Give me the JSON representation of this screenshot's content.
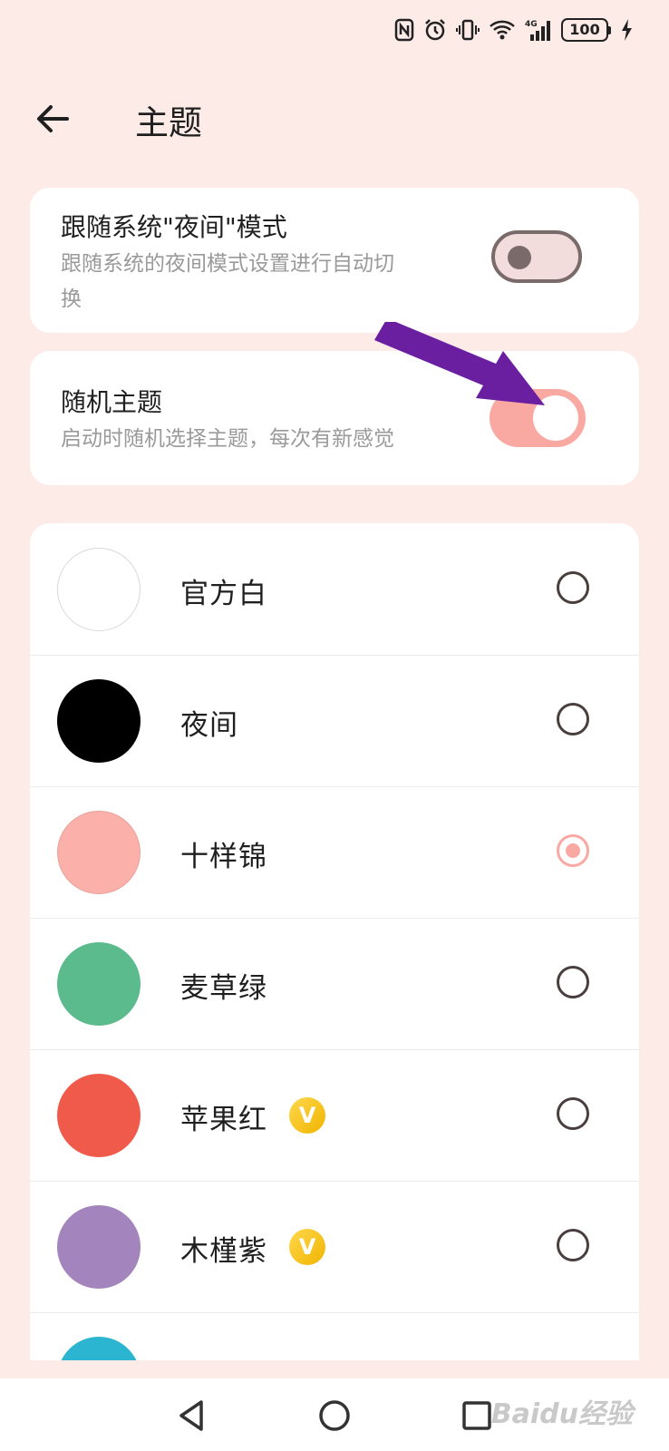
{
  "status_bar": {
    "battery": "100"
  },
  "header": {
    "title": "主题"
  },
  "settings": [
    {
      "title": "跟随系统\"夜间\"模式",
      "description_line1": "跟随系统的夜间模式设置进行自动切",
      "description_line2": "换",
      "toggle_on": false
    },
    {
      "title": "随机主题",
      "description": "启动时随机选择主题，每次有新感觉",
      "toggle_on": true
    }
  ],
  "themes": [
    {
      "name": "官方白",
      "color": "#ffffff",
      "selected": false,
      "vip": false
    },
    {
      "name": "夜间",
      "color": "#000000",
      "selected": false,
      "vip": false
    },
    {
      "name": "十样锦",
      "color": "#fbb0aa",
      "selected": true,
      "vip": false
    },
    {
      "name": "麦草绿",
      "color": "#5bbb8c",
      "selected": false,
      "vip": false
    },
    {
      "name": "苹果红",
      "color": "#f05a4a",
      "selected": false,
      "vip": true,
      "badge": "V"
    },
    {
      "name": "木槿紫",
      "color": "#a384bc",
      "selected": false,
      "vip": true,
      "badge": "V"
    },
    {
      "name": "",
      "color": "#2bb5d0",
      "selected": false,
      "vip": false
    }
  ],
  "colors": {
    "background": "#fdebe7",
    "accent": "#f9a8a2",
    "annotation_arrow": "#6a1fa0"
  },
  "watermark": "Baidu经验"
}
